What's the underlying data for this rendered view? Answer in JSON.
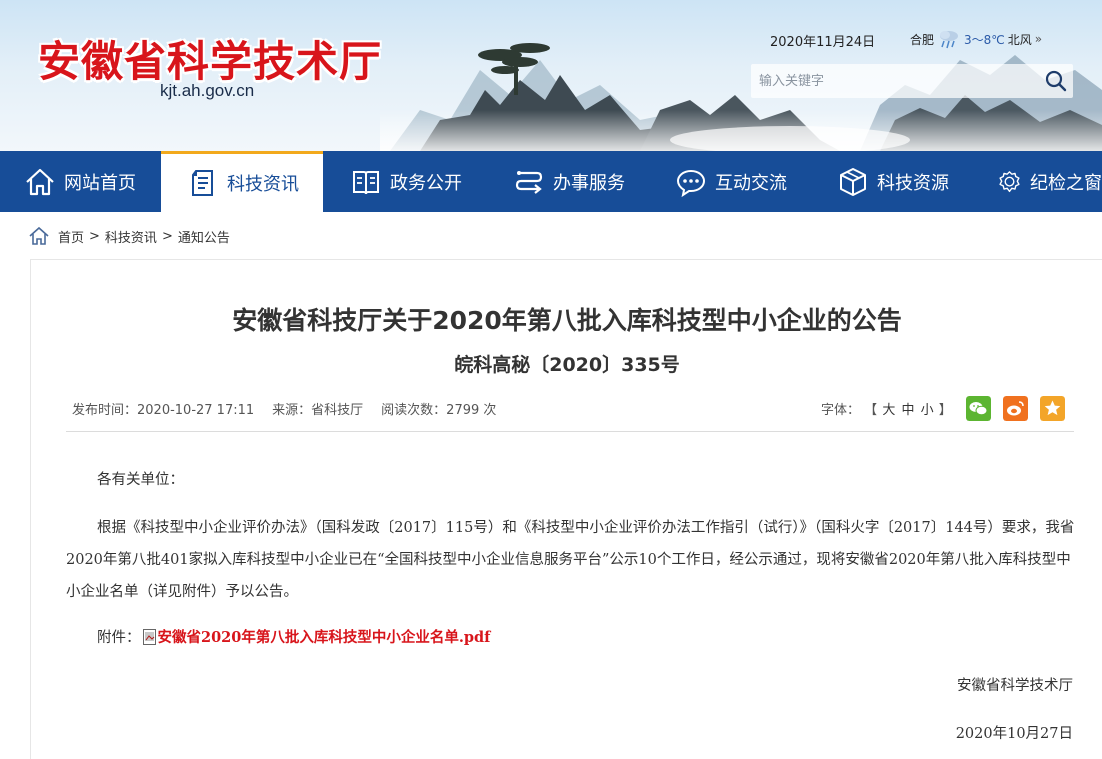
{
  "header": {
    "site_title": "安徽省科学技术厅",
    "site_url": "kjt.ah.gov.cn",
    "date": "2020年11月24日",
    "weather": {
      "city": "合肥",
      "temperature": "3～8℃",
      "wind": "北风",
      "more": "»",
      "icon": "cloud-rain-icon"
    },
    "search": {
      "placeholder": "输入关键字",
      "button_icon": "search-icon"
    }
  },
  "nav": [
    {
      "label": "网站首页",
      "icon": "home-icon"
    },
    {
      "label": "科技资讯",
      "icon": "news-document-icon",
      "active": true
    },
    {
      "label": "政务公开",
      "icon": "book-icon"
    },
    {
      "label": "办事服务",
      "icon": "service-route-icon"
    },
    {
      "label": "互动交流",
      "icon": "chat-bubble-icon"
    },
    {
      "label": "科技资源",
      "icon": "cube-icon"
    },
    {
      "label": "纪检之窗",
      "icon": "badge-icon"
    }
  ],
  "breadcrumb": {
    "home": "首页",
    "sep1": ">",
    "level1": "科技资讯",
    "sep2": ">",
    "level2": "通知公告",
    "icon": "home-icon"
  },
  "article": {
    "title": "安徽省科技厅关于2020年第八批入库科技型中小企业的公告",
    "doc_number": "皖科高秘〔2020〕335号",
    "meta": {
      "publish_time": "发布时间：2020-10-27 17:11",
      "source": "来源：省科技厅",
      "views": "阅读次数：2799 次"
    },
    "font_size": {
      "label": "字体：",
      "open": "【",
      "large": "大",
      "medium": "中",
      "small": "小",
      "close": "】"
    },
    "share": [
      {
        "icon": "wechat-icon",
        "color": "#5cb531"
      },
      {
        "icon": "weibo-icon",
        "color": "#f0711f"
      },
      {
        "icon": "favorite-star-icon",
        "color": "#f3a529"
      }
    ],
    "greeting": "各有关单位：",
    "body": "根据《科技型中小企业评价办法》（国科发政〔2017〕115号）和《科技型中小企业评价办法工作指引（试行）》（国科火字〔2017〕144号）要求，我省2020年第八批401家拟入库科技型中小企业已在“全国科技型中小企业信息服务平台”公示10个工作日，经公示通过，现将安徽省2020年第八批入库科技型中小企业名单（详见附件）予以公告。",
    "attachment_label": "附件：",
    "attachment_link": "安徽省2020年第八批入库科技型中小企业名单.pdf",
    "signature_org": "安徽省科学技术厅",
    "signature_date": "2020年10月27日"
  },
  "colors": {
    "brand_red": "#d8151b",
    "nav_blue": "#174d98",
    "active_accent": "#f2a91c"
  }
}
